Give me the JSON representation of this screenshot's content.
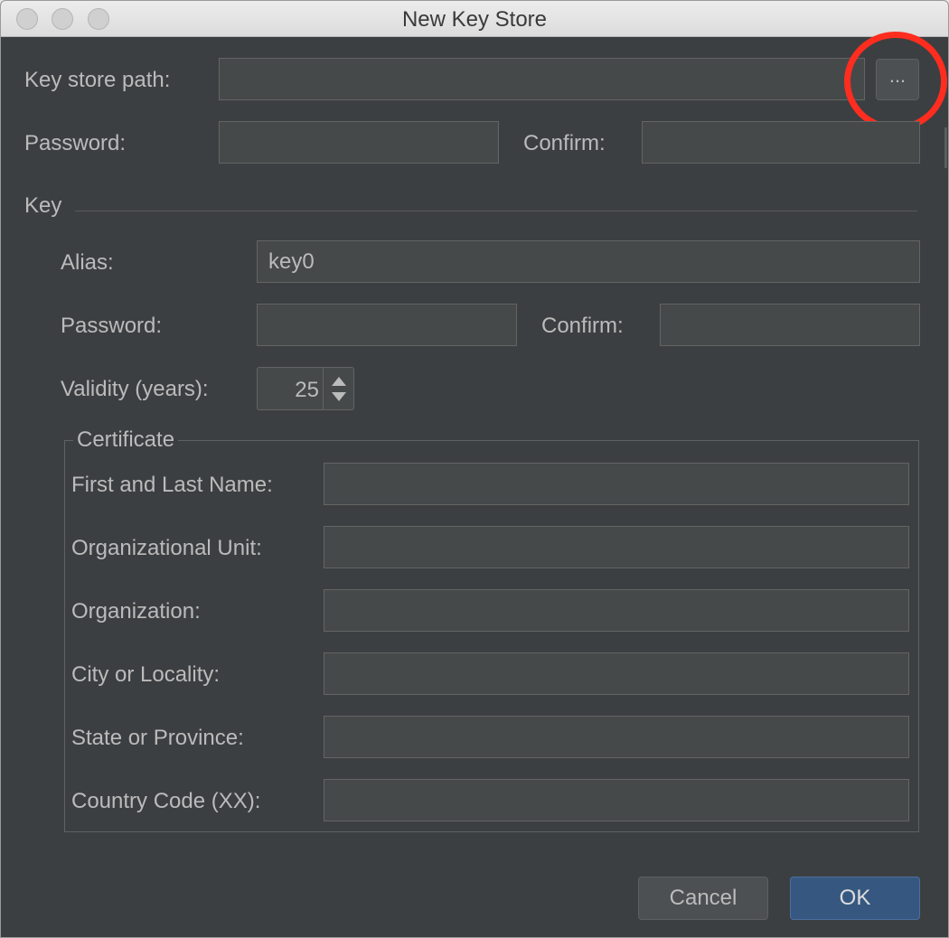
{
  "window": {
    "title": "New Key Store"
  },
  "keystore": {
    "path_label": "Key store path:",
    "path_value": "",
    "browse_label": "...",
    "password_label": "Password:",
    "confirm_label": "Confirm:"
  },
  "key": {
    "section_label": "Key",
    "alias_label": "Alias:",
    "alias_value": "key0",
    "password_label": "Password:",
    "confirm_label": "Confirm:",
    "validity_label": "Validity (years):",
    "validity_value": "25"
  },
  "certificate": {
    "legend": "Certificate",
    "fields": [
      {
        "label": "First and Last Name:",
        "value": ""
      },
      {
        "label": "Organizational Unit:",
        "value": ""
      },
      {
        "label": "Organization:",
        "value": ""
      },
      {
        "label": "City or Locality:",
        "value": ""
      },
      {
        "label": "State or Province:",
        "value": ""
      },
      {
        "label": "Country Code (XX):",
        "value": ""
      }
    ]
  },
  "buttons": {
    "cancel": "Cancel",
    "ok": "OK"
  },
  "colors": {
    "dialog_bg": "#3c3f41",
    "field_bg": "#45494a",
    "text": "#bbbbbb",
    "primary_button": "#365880",
    "highlight_ring": "#ff2d1f"
  }
}
